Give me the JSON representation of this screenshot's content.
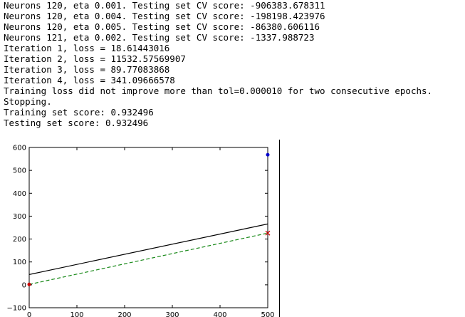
{
  "console": {
    "lines": [
      "Neurons 120, eta 0.001. Testing set CV score: -906383.678311",
      "Neurons 120, eta 0.004. Testing set CV score: -198198.423976",
      "Neurons 120, eta 0.005. Testing set CV score: -86380.606116",
      "Neurons 121, eta 0.002. Testing set CV score: -1337.988723",
      "Iteration 1, loss = 18.61443016",
      "Iteration 2, loss = 11532.57569907",
      "Iteration 3, loss = 89.77083868",
      "Iteration 4, loss = 341.09666578",
      "Training loss did not improve more than tol=0.000010 for two consecutive epochs.",
      "Stopping.",
      "Training set score: 0.932496",
      "Testing set score: 0.932496"
    ]
  },
  "chart_data": {
    "type": "line",
    "x_ticks": [
      "0",
      "100",
      "200",
      "300",
      "400",
      "500"
    ],
    "y_ticks": [
      "600",
      "500",
      "400",
      "300",
      "200",
      "100",
      "0",
      "−100"
    ],
    "xlim": [
      0,
      500
    ],
    "ylim": [
      -100,
      600
    ],
    "grid": false,
    "series": [
      {
        "style": "solid",
        "color": "#000000",
        "x": [
          0,
          500
        ],
        "y": [
          45,
          266
        ]
      },
      {
        "style": "dashed",
        "color": "#1a8a1a",
        "x": [
          0,
          500
        ],
        "y": [
          2,
          226
        ]
      }
    ],
    "points": [
      {
        "marker": "dot",
        "color": "#0000cc",
        "x": 500,
        "y": 568
      },
      {
        "marker": "x",
        "color": "#cc0000",
        "x": 500,
        "y": 226
      },
      {
        "marker": "dot",
        "color": "#cc0000",
        "x": 0,
        "y": 2
      }
    ]
  }
}
